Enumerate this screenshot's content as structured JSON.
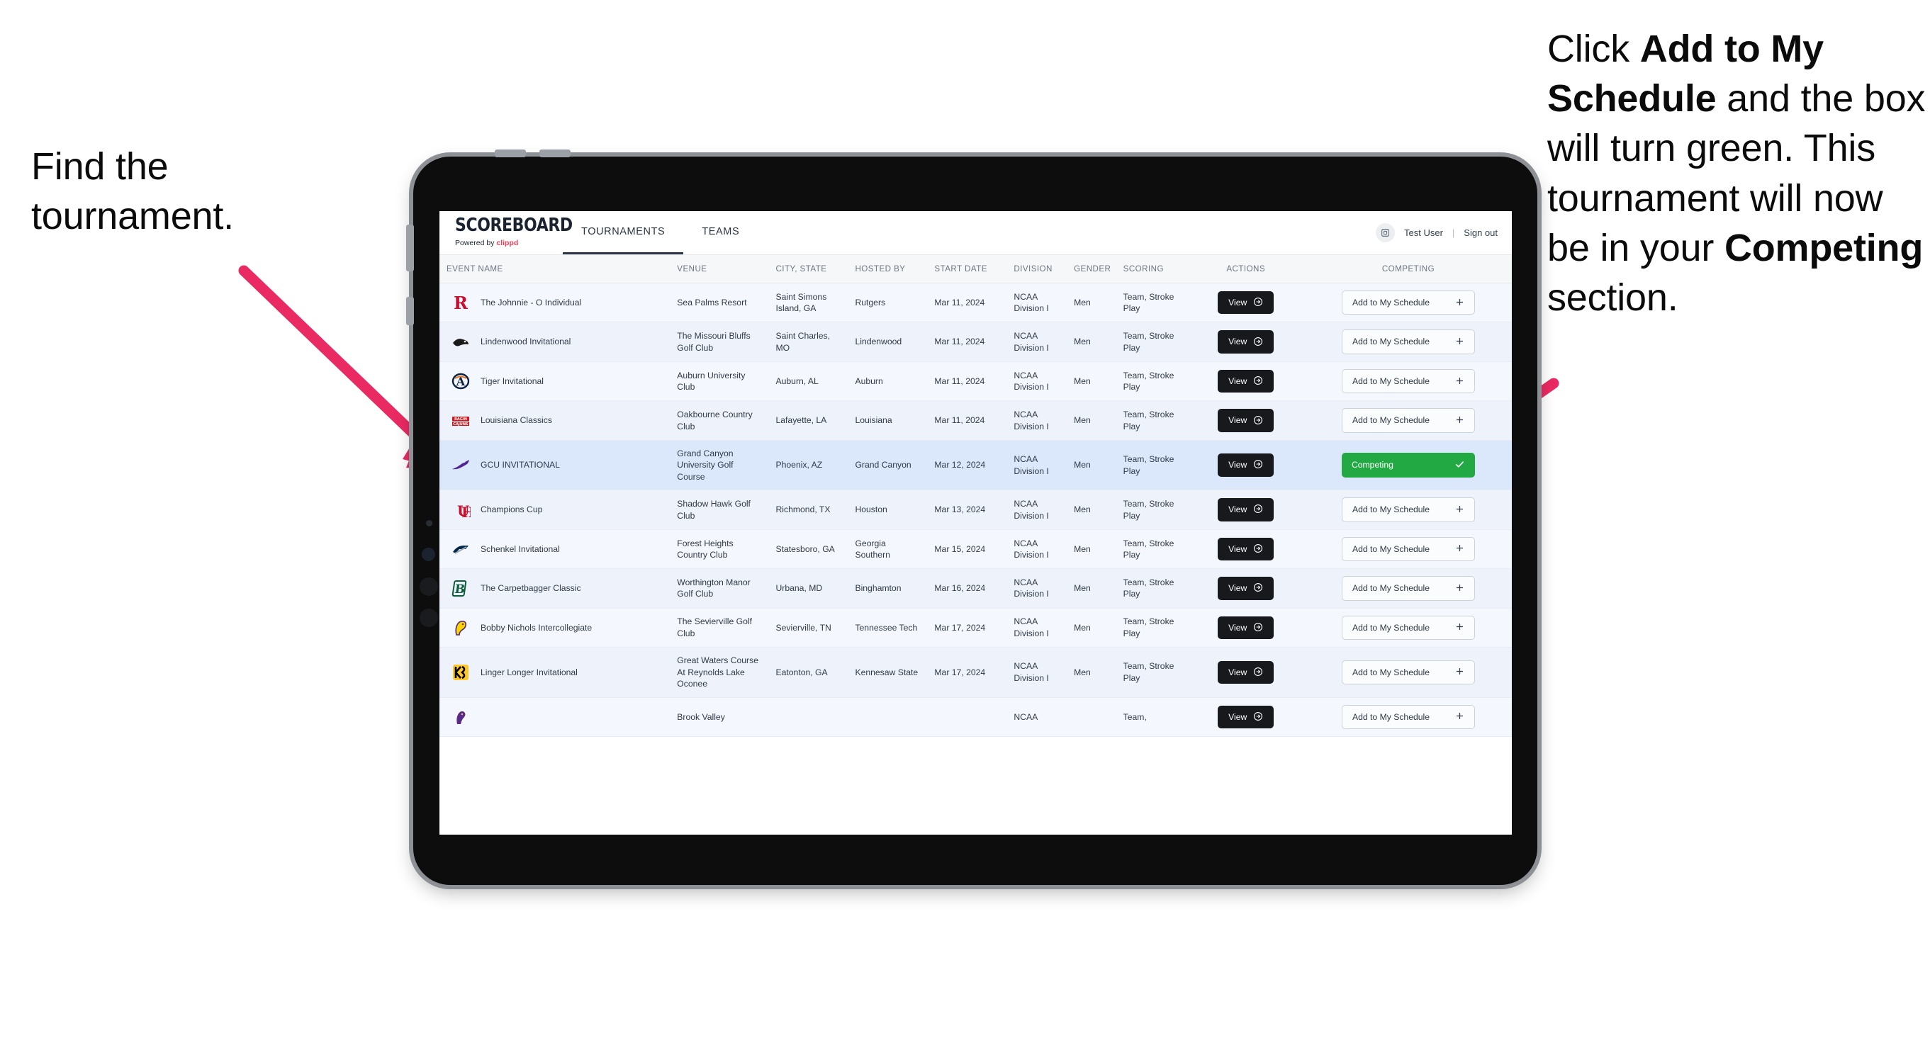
{
  "annotations": {
    "left": {
      "line1": "Find the",
      "line2": "tournament."
    },
    "right": {
      "p1_pre": "Click ",
      "p1_bold": "Add to My Schedule",
      "p1_post": " and the box will turn green. This tournament will now be in your ",
      "p2_bold": "Competing",
      "p2_post": " section."
    },
    "arrow_color": "#ea2a62"
  },
  "app": {
    "brand": {
      "name": "SCOREBOARD",
      "powered_prefix": "Powered by ",
      "powered_brand": "clippd"
    },
    "tabs": [
      {
        "label": "TOURNAMENTS",
        "active": true
      },
      {
        "label": "TEAMS",
        "active": false
      }
    ],
    "account": {
      "avatar_icon": "user-avatar-icon",
      "user": "Test User",
      "separator": "|",
      "signout": "Sign out"
    },
    "table": {
      "columns": [
        "EVENT NAME",
        "VENUE",
        "CITY, STATE",
        "HOSTED BY",
        "START DATE",
        "DIVISION",
        "GENDER",
        "SCORING",
        "ACTIONS",
        "COMPETING"
      ],
      "view_label": "View",
      "view_icon": "arrow-right-circle-icon",
      "add_label": "Add to My Schedule",
      "add_icon": "plus-icon",
      "competing_label": "Competing",
      "competing_icon": "check-icon",
      "competing_color": "#23a944",
      "selected_row_color": "#dbe7fb",
      "rows": [
        {
          "event": "The Johnnie - O Individual",
          "venue": "Sea Palms Resort",
          "city": "Saint Simons Island, GA",
          "hosted_by": "Rutgers",
          "start_date": "Mar 11, 2024",
          "division": "NCAA Division I",
          "gender": "Men",
          "scoring": "Team, Stroke Play",
          "competing": false,
          "logo": "rutgers-logo"
        },
        {
          "event": "Lindenwood Invitational",
          "venue": "The Missouri Bluffs Golf Club",
          "city": "Saint Charles, MO",
          "hosted_by": "Lindenwood",
          "start_date": "Mar 11, 2024",
          "division": "NCAA Division I",
          "gender": "Men",
          "scoring": "Team, Stroke Play",
          "competing": false,
          "logo": "lindenwood-logo"
        },
        {
          "event": "Tiger Invitational",
          "venue": "Auburn University Club",
          "city": "Auburn, AL",
          "hosted_by": "Auburn",
          "start_date": "Mar 11, 2024",
          "division": "NCAA Division I",
          "gender": "Men",
          "scoring": "Team, Stroke Play",
          "competing": false,
          "logo": "auburn-logo"
        },
        {
          "event": "Louisiana Classics",
          "venue": "Oakbourne Country Club",
          "city": "Lafayette, LA",
          "hosted_by": "Louisiana",
          "start_date": "Mar 11, 2024",
          "division": "NCAA Division I",
          "gender": "Men",
          "scoring": "Team, Stroke Play",
          "competing": false,
          "logo": "ragin-cajuns-logo"
        },
        {
          "event": "GCU INVITATIONAL",
          "venue": "Grand Canyon University Golf Course",
          "city": "Phoenix, AZ",
          "hosted_by": "Grand Canyon",
          "start_date": "Mar 12, 2024",
          "division": "NCAA Division I",
          "gender": "Men",
          "scoring": "Team, Stroke Play",
          "competing": true,
          "logo": "grand-canyon-lopes-logo"
        },
        {
          "event": "Champions Cup",
          "venue": "Shadow Hawk Golf Club",
          "city": "Richmond, TX",
          "hosted_by": "Houston",
          "start_date": "Mar 13, 2024",
          "division": "NCAA Division I",
          "gender": "Men",
          "scoring": "Team, Stroke Play",
          "competing": false,
          "logo": "houston-logo"
        },
        {
          "event": "Schenkel Invitational",
          "venue": "Forest Heights Country Club",
          "city": "Statesboro, GA",
          "hosted_by": "Georgia Southern",
          "start_date": "Mar 15, 2024",
          "division": "NCAA Division I",
          "gender": "Men",
          "scoring": "Team, Stroke Play",
          "competing": false,
          "logo": "georgia-southern-logo"
        },
        {
          "event": "The Carpetbagger Classic",
          "venue": "Worthington Manor Golf Club",
          "city": "Urbana, MD",
          "hosted_by": "Binghamton",
          "start_date": "Mar 16, 2024",
          "division": "NCAA Division I",
          "gender": "Men",
          "scoring": "Team, Stroke Play",
          "competing": false,
          "logo": "binghamton-logo"
        },
        {
          "event": "Bobby Nichols Intercollegiate",
          "venue": "The Sevierville Golf Club",
          "city": "Sevierville, TN",
          "hosted_by": "Tennessee Tech",
          "start_date": "Mar 17, 2024",
          "division": "NCAA Division I",
          "gender": "Men",
          "scoring": "Team, Stroke Play",
          "competing": false,
          "logo": "tennessee-tech-logo"
        },
        {
          "event": "Linger Longer Invitational",
          "venue": "Great Waters Course At Reynolds Lake Oconee",
          "city": "Eatonton, GA",
          "hosted_by": "Kennesaw State",
          "start_date": "Mar 17, 2024",
          "division": "NCAA Division I",
          "gender": "Men",
          "scoring": "Team, Stroke Play",
          "competing": false,
          "logo": "kennesaw-state-logo"
        },
        {
          "event": "",
          "venue": "Brook Valley",
          "city": "",
          "hosted_by": "",
          "start_date": "",
          "division": "NCAA",
          "gender": "",
          "scoring": "Team,",
          "competing": false,
          "logo": "east-carolina-logo"
        }
      ]
    }
  }
}
